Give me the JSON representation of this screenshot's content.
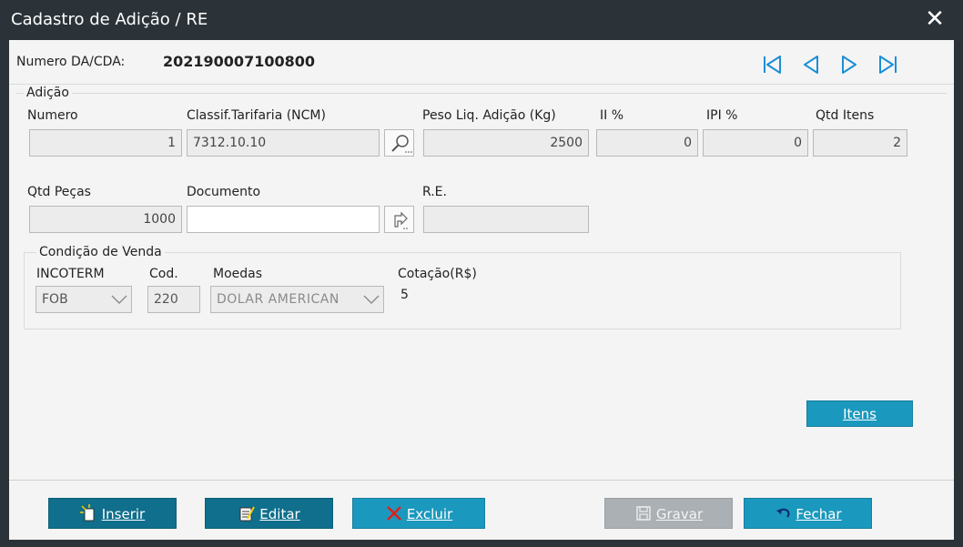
{
  "window": {
    "title": "Cadastro de Adição / RE",
    "close_glyph": "✕"
  },
  "header": {
    "numero_label": "Numero DA/CDA:",
    "numero_value": "202190007100800"
  },
  "adicao": {
    "group_label": "Adição",
    "numero": {
      "label": "Numero",
      "value": "1"
    },
    "classif": {
      "label": "Classif.Tarifaria  (NCM)",
      "value": "7312.10.10"
    },
    "peso": {
      "label": "Peso Liq. Adição (Kg)",
      "value": "2500"
    },
    "ii": {
      "label": "II %",
      "value": "0"
    },
    "ipi": {
      "label": "IPI %",
      "value": "0"
    },
    "qtd_itens": {
      "label": "Qtd Itens",
      "value": "2"
    },
    "qtd_pecas": {
      "label": "Qtd Peças",
      "value": "1000"
    },
    "documento": {
      "label": "Documento",
      "value": ""
    },
    "re": {
      "label": "R.E.",
      "value": ""
    }
  },
  "venda": {
    "group_label": "Condição de Venda",
    "incoterm": {
      "label": "INCOTERM",
      "value": "FOB"
    },
    "cod": {
      "label": "Cod.",
      "value": "220"
    },
    "moedas": {
      "label": "Moedas",
      "value": "DOLAR AMERICAN"
    },
    "cotacao": {
      "label": "Cotação(R$)",
      "value": "5"
    }
  },
  "buttons": {
    "itens": "Itens",
    "inserir": "Inserir",
    "editar": "Editar",
    "excluir": "Excluir",
    "gravar": "Gravar",
    "fechar": "Fechar"
  },
  "icons": [
    "first-record-icon",
    "previous-record-icon",
    "next-record-icon",
    "last-record-icon",
    "search-icon",
    "attach-icon",
    "insert-icon",
    "edit-icon",
    "delete-icon",
    "save-icon",
    "undo-icon"
  ],
  "colors": {
    "nav_blue": "#1a8fd6",
    "button_dark": "#0f6f8c",
    "button_light": "#1b98bd",
    "delete_red": "#e0201b"
  }
}
